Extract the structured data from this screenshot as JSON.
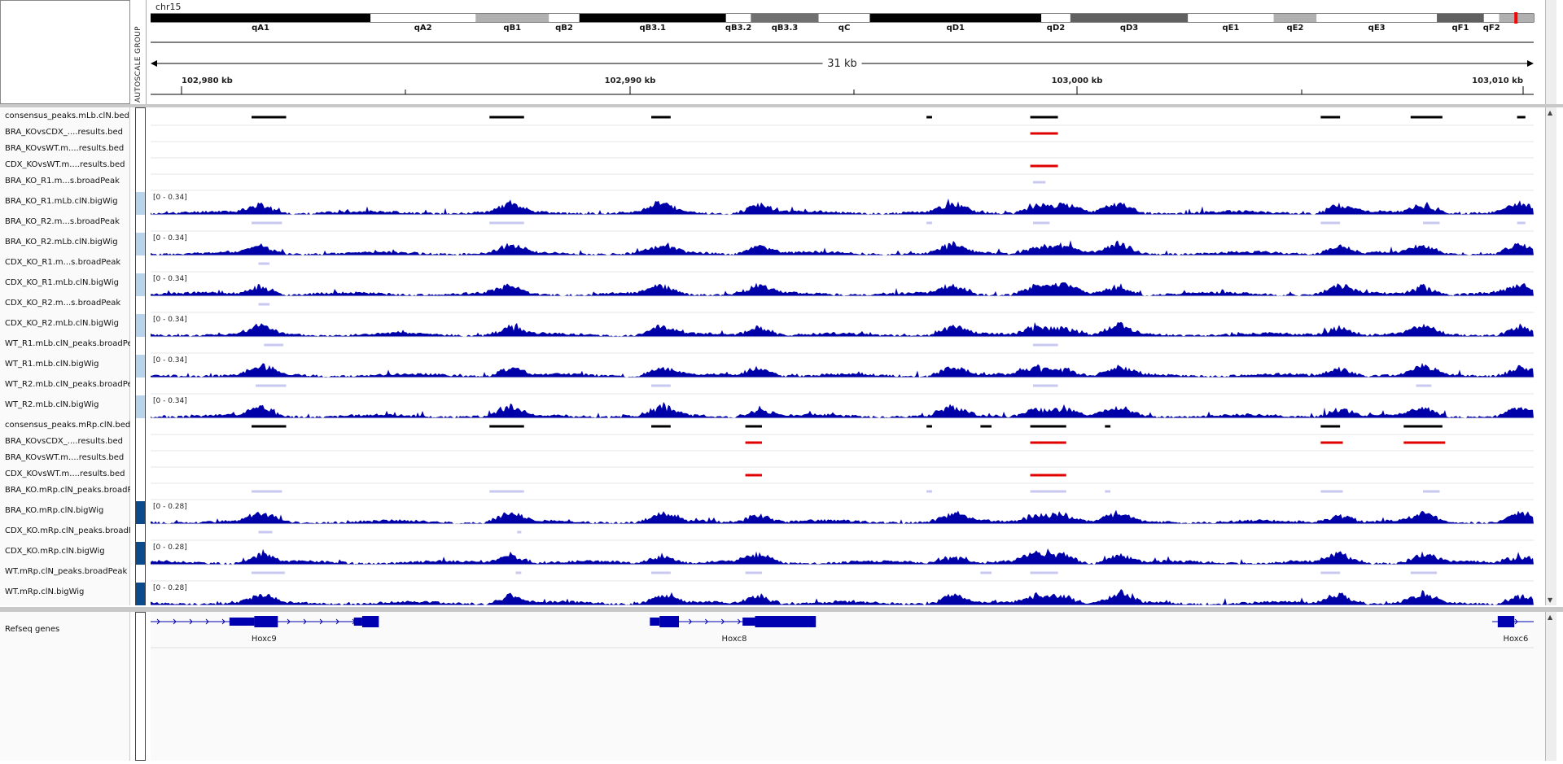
{
  "header": {
    "chromosome": "chr15",
    "attribute_label": "AUTOSCALE GROUP",
    "span_label": "31 kb",
    "ruler_ticks": [
      "102,980 kb",
      "102,990 kb",
      "103,000 kb",
      "103,010 kb"
    ],
    "cytobands": [
      {
        "name": "qA1",
        "start": 0,
        "end": 0.159,
        "color": "#000000",
        "dark": true
      },
      {
        "name": "qA2",
        "start": 0.159,
        "end": 0.235,
        "color": "#ffffff"
      },
      {
        "name": "qB1",
        "start": 0.235,
        "end": 0.288,
        "color": "#b0b0b0"
      },
      {
        "name": "qB2",
        "start": 0.288,
        "end": 0.31,
        "color": "#ffffff"
      },
      {
        "name": "qB3.1",
        "start": 0.31,
        "end": 0.416,
        "color": "#000000",
        "dark": true
      },
      {
        "name": "qB3.2",
        "start": 0.416,
        "end": 0.434,
        "color": "#ffffff"
      },
      {
        "name": "qB3.3",
        "start": 0.434,
        "end": 0.483,
        "color": "#707070"
      },
      {
        "name": "qC",
        "start": 0.483,
        "end": 0.52,
        "color": "#ffffff"
      },
      {
        "name": "qD1",
        "start": 0.52,
        "end": 0.644,
        "color": "#000000",
        "dark": true
      },
      {
        "name": "qD2",
        "start": 0.644,
        "end": 0.665,
        "color": "#ffffff"
      },
      {
        "name": "qD3",
        "start": 0.665,
        "end": 0.75,
        "color": "#606060"
      },
      {
        "name": "qE1",
        "start": 0.75,
        "end": 0.812,
        "color": "#ffffff"
      },
      {
        "name": "qE2",
        "start": 0.812,
        "end": 0.843,
        "color": "#b0b0b0"
      },
      {
        "name": "qE3",
        "start": 0.843,
        "end": 0.93,
        "color": "#ffffff"
      },
      {
        "name": "qF1",
        "start": 0.93,
        "end": 0.964,
        "color": "#606060"
      },
      {
        "name": "qF2",
        "start": 0.964,
        "end": 0.975,
        "color": "#ffffff"
      },
      {
        "name": "",
        "start": 0.975,
        "end": 1.0,
        "color": "#b0b0b0"
      }
    ],
    "ideogram_marker_color": "#ff0000"
  },
  "tracks": [
    {
      "name": "consensus_peaks.mLb.clN.bed",
      "type": "bed",
      "color": "#000000",
      "peaks": [
        [
          0.073,
          0.098
        ],
        [
          0.245,
          0.27
        ],
        [
          0.362,
          0.376
        ],
        [
          0.561,
          0.565
        ],
        [
          0.636,
          0.656
        ],
        [
          0.846,
          0.86
        ],
        [
          0.911,
          0.934
        ],
        [
          0.988,
          0.994
        ]
      ]
    },
    {
      "name": "BRA_KOvsCDX_....results.bed",
      "type": "bed",
      "color": "#e00000",
      "peaks": [
        [
          0.636,
          0.656
        ]
      ]
    },
    {
      "name": "BRA_KOvsWT.m....results.bed",
      "type": "bed",
      "color": "#e00000",
      "peaks": []
    },
    {
      "name": "CDX_KOvsWT.m....results.bed",
      "type": "bed",
      "color": "#e00000",
      "peaks": [
        [
          0.636,
          0.656
        ]
      ]
    },
    {
      "name": "BRA_KO_R1.m...s.broadPeak",
      "type": "broadpeak",
      "color": "#c8c8f0",
      "peaks": [
        [
          0.638,
          0.647
        ]
      ]
    },
    {
      "name": "BRA_KO_R1.mLb.clN.bigWig",
      "type": "bigwig",
      "range": "[0 - 0.34]",
      "color": "#0000a8",
      "seed": 11,
      "attr_color": "#b8d4ec"
    },
    {
      "name": "BRA_KO_R2.m...s.broadPeak",
      "type": "broadpeak",
      "color": "#c8c8f0",
      "peaks": [
        [
          0.073,
          0.095
        ],
        [
          0.245,
          0.27
        ],
        [
          0.561,
          0.565
        ],
        [
          0.638,
          0.65
        ],
        [
          0.846,
          0.86
        ],
        [
          0.92,
          0.932
        ],
        [
          0.988,
          0.994
        ]
      ]
    },
    {
      "name": "BRA_KO_R2.mLb.clN.bigWig",
      "type": "bigwig",
      "range": "[0 - 0.34]",
      "color": "#0000a8",
      "seed": 23,
      "attr_color": "#b8d4ec"
    },
    {
      "name": "CDX_KO_R1.m...s.broadPeak",
      "type": "broadpeak",
      "color": "#c8c8f0",
      "peaks": [
        [
          0.078,
          0.086
        ]
      ]
    },
    {
      "name": "CDX_KO_R1.mLb.clN.bigWig",
      "type": "bigwig",
      "range": "[0 - 0.34]",
      "color": "#0000a8",
      "seed": 37,
      "attr_color": "#b8d4ec"
    },
    {
      "name": "CDX_KO_R2.m...s.broadPeak",
      "type": "broadpeak",
      "color": "#c8c8f0",
      "peaks": [
        [
          0.078,
          0.086
        ]
      ]
    },
    {
      "name": "CDX_KO_R2.mLb.clN.bigWig",
      "type": "bigwig",
      "range": "[0 - 0.34]",
      "color": "#0000a8",
      "seed": 41,
      "attr_color": "#b8d4ec"
    },
    {
      "name": "WT_R1.mLb.clN_peaks.broadPea",
      "type": "broadpeak",
      "color": "#c8c8f0",
      "peaks": [
        [
          0.082,
          0.096
        ],
        [
          0.638,
          0.656
        ]
      ]
    },
    {
      "name": "WT_R1.mLb.clN.bigWig",
      "type": "bigwig",
      "range": "[0 - 0.34]",
      "color": "#0000a8",
      "seed": 53,
      "attr_color": "#b8d4ec"
    },
    {
      "name": "WT_R2.mLb.clN_peaks.broadPea",
      "type": "broadpeak",
      "color": "#c8c8f0",
      "peaks": [
        [
          0.076,
          0.098
        ],
        [
          0.362,
          0.376
        ],
        [
          0.638,
          0.656
        ],
        [
          0.915,
          0.926
        ]
      ]
    },
    {
      "name": "WT_R2.mLb.clN.bigWig",
      "type": "bigwig",
      "range": "[0 - 0.34]",
      "color": "#0000a8",
      "seed": 67,
      "attr_color": "#b8d4ec"
    },
    {
      "name": "consensus_peaks.mRp.clN.bed",
      "type": "bed",
      "color": "#000000",
      "peaks": [
        [
          0.073,
          0.098
        ],
        [
          0.245,
          0.27
        ],
        [
          0.362,
          0.376
        ],
        [
          0.43,
          0.442
        ],
        [
          0.561,
          0.565
        ],
        [
          0.6,
          0.608
        ],
        [
          0.636,
          0.662
        ],
        [
          0.69,
          0.694
        ],
        [
          0.846,
          0.86
        ],
        [
          0.906,
          0.934
        ]
      ]
    },
    {
      "name": "BRA_KOvsCDX_....results.bed",
      "type": "bed",
      "color": "#e00000",
      "peaks": [
        [
          0.43,
          0.442
        ],
        [
          0.636,
          0.662
        ],
        [
          0.846,
          0.862
        ],
        [
          0.906,
          0.936
        ]
      ]
    },
    {
      "name": "BRA_KOvsWT.m....results.bed",
      "type": "bed",
      "color": "#e00000",
      "peaks": []
    },
    {
      "name": "CDX_KOvsWT.m....results.bed",
      "type": "bed",
      "color": "#e00000",
      "peaks": [
        [
          0.43,
          0.442
        ],
        [
          0.636,
          0.662
        ]
      ]
    },
    {
      "name": "BRA_KO.mRp.clN_peaks.broadP",
      "type": "broadpeak",
      "color": "#c8c8f0",
      "peaks": [
        [
          0.073,
          0.095
        ],
        [
          0.245,
          0.27
        ],
        [
          0.561,
          0.565
        ],
        [
          0.636,
          0.662
        ],
        [
          0.69,
          0.694
        ],
        [
          0.846,
          0.862
        ],
        [
          0.92,
          0.932
        ]
      ]
    },
    {
      "name": "BRA_KO.mRp.clN.bigWig",
      "type": "bigwig",
      "range": "[0 - 0.28]",
      "color": "#0000a8",
      "seed": 79,
      "attr_color": "#0b4a8c"
    },
    {
      "name": "CDX_KO.mRp.clN_peaks.broadF",
      "type": "broadpeak",
      "color": "#c8c8f0",
      "peaks": [
        [
          0.078,
          0.088
        ],
        [
          0.265,
          0.268
        ]
      ]
    },
    {
      "name": "CDX_KO.mRp.clN.bigWig",
      "type": "bigwig",
      "range": "[0 - 0.28]",
      "color": "#0000a8",
      "seed": 83,
      "attr_color": "#0b4a8c"
    },
    {
      "name": "WT.mRp.clN_peaks.broadPeak",
      "type": "broadpeak",
      "color": "#c8c8f0",
      "peaks": [
        [
          0.073,
          0.097
        ],
        [
          0.264,
          0.268
        ],
        [
          0.362,
          0.376
        ],
        [
          0.43,
          0.442
        ],
        [
          0.6,
          0.608
        ],
        [
          0.636,
          0.656
        ],
        [
          0.846,
          0.86
        ],
        [
          0.911,
          0.93
        ]
      ]
    },
    {
      "name": "WT.mRp.clN.bigWig",
      "type": "bigwig",
      "range": "[0 - 0.28]",
      "color": "#0000a8",
      "seed": 97,
      "attr_color": "#0b4a8c"
    }
  ],
  "genes": {
    "track_name": "Refseq genes",
    "color": "#0000b0",
    "items": [
      {
        "name": "Hoxc9",
        "label_pos": 0.082,
        "start": 0.0,
        "end": 0.165,
        "exons": [
          [
            0.057,
            0.075
          ],
          [
            0.075,
            0.092
          ],
          [
            0.147,
            0.153
          ],
          [
            0.153,
            0.165
          ]
        ]
      },
      {
        "name": "Hoxc8",
        "label_pos": 0.422,
        "start": 0.361,
        "end": 0.481,
        "exons": [
          [
            0.361,
            0.368
          ],
          [
            0.368,
            0.382
          ],
          [
            0.428,
            0.437
          ],
          [
            0.437,
            0.481
          ]
        ]
      },
      {
        "name": "Hoxc6",
        "label_pos": 0.987,
        "start": 0.97,
        "end": 1.0,
        "exons": [
          [
            0.974,
            0.986
          ]
        ]
      }
    ]
  }
}
